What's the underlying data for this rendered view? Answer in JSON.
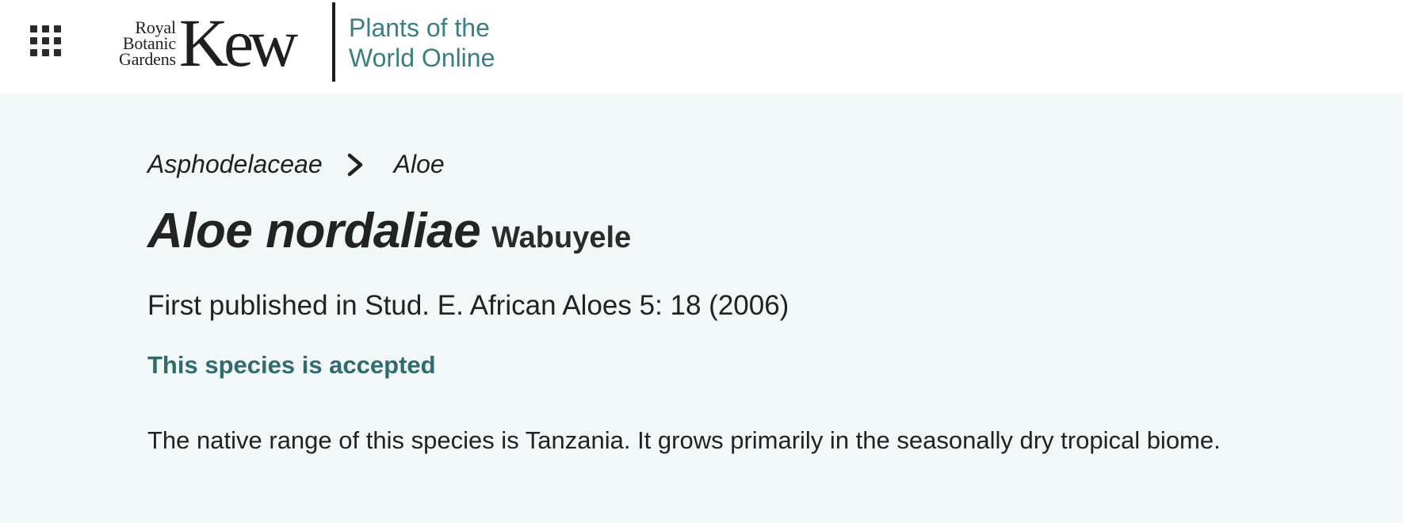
{
  "header": {
    "logo": {
      "line1": "Royal",
      "line2": "Botanic",
      "line3": "Gardens",
      "wordmark": "Kew"
    },
    "site_name_line1": "Plants of the",
    "site_name_line2": "World Online"
  },
  "breadcrumb": {
    "family": "Asphodelaceae",
    "genus": "Aloe"
  },
  "taxon": {
    "name": "Aloe nordaliae",
    "author": "Wabuyele",
    "publication": "First published in Stud. E. African Aloes 5: 18 (2006)",
    "status": "This species is accepted",
    "range_summary": "The native range of this species is Tanzania. It grows primarily in the seasonally dry tropical biome."
  },
  "colors": {
    "accent": "#3a7f82",
    "status": "#2f6c72",
    "background": "#f2f7f7",
    "header_bg": "#ffffff",
    "text": "#222222"
  },
  "icons": {
    "apps": "apps-grid-icon",
    "separator": "chevron-right-icon"
  }
}
